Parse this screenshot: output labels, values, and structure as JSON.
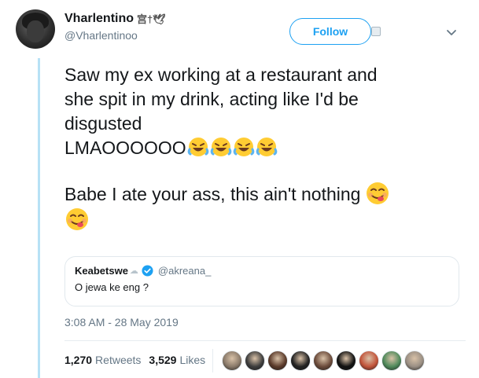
{
  "user": {
    "name": "Vharlentino",
    "name_decoration": "宫†🕊",
    "handle": "@Vharlentinoo"
  },
  "header": {
    "follow_label": "Follow"
  },
  "tweet": {
    "line1": "Saw my ex working at a restaurant and",
    "line2": "she spit in my drink, acting like I'd be",
    "line3": "disgusted",
    "line4": "LMAOOOOOO",
    "line5": "Babe I ate your ass, this ain't nothing"
  },
  "icons": {
    "avatar": "avatar",
    "follow_notch": "follow-notch-icon",
    "chevron": "chevron-down-icon",
    "laugh": "rolling-on-floor-laughing-emoji",
    "yum": "face-savoring-food-emoji",
    "verified": "verified-badge-icon"
  },
  "quote": {
    "name": "Keabetswe",
    "name_decoration": "☁",
    "handle": "@akreana_",
    "body": "O jewa ke eng ?"
  },
  "timestamp": "3:08 AM - 28 May 2019",
  "stats": {
    "retweets_count": "1,270",
    "retweets_label": "Retweets",
    "likes_count": "3,529",
    "likes_label": "Likes"
  },
  "colors": {
    "accent": "#1da1f2",
    "thread_line": "#b7e1f5",
    "muted_text": "#657786",
    "liker_avatars": [
      "#8a7a6a",
      "#3d3d3d",
      "#5a3a2a",
      "#222222",
      "#6b4b3b",
      "#111111",
      "#c2543a",
      "#4f8a5b",
      "#9a8f84"
    ]
  }
}
